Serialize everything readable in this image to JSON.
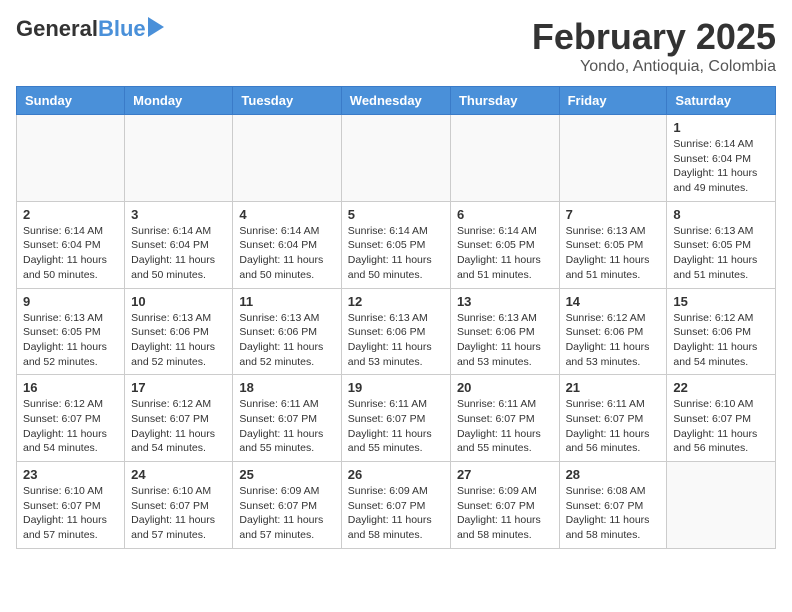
{
  "header": {
    "logo_general": "General",
    "logo_blue": "Blue",
    "main_title": "February 2025",
    "sub_title": "Yondo, Antioquia, Colombia"
  },
  "columns": [
    "Sunday",
    "Monday",
    "Tuesday",
    "Wednesday",
    "Thursday",
    "Friday",
    "Saturday"
  ],
  "weeks": [
    [
      {
        "day": "",
        "info": ""
      },
      {
        "day": "",
        "info": ""
      },
      {
        "day": "",
        "info": ""
      },
      {
        "day": "",
        "info": ""
      },
      {
        "day": "",
        "info": ""
      },
      {
        "day": "",
        "info": ""
      },
      {
        "day": "1",
        "info": "Sunrise: 6:14 AM\nSunset: 6:04 PM\nDaylight: 11 hours and 49 minutes."
      }
    ],
    [
      {
        "day": "2",
        "info": "Sunrise: 6:14 AM\nSunset: 6:04 PM\nDaylight: 11 hours and 50 minutes."
      },
      {
        "day": "3",
        "info": "Sunrise: 6:14 AM\nSunset: 6:04 PM\nDaylight: 11 hours and 50 minutes."
      },
      {
        "day": "4",
        "info": "Sunrise: 6:14 AM\nSunset: 6:04 PM\nDaylight: 11 hours and 50 minutes."
      },
      {
        "day": "5",
        "info": "Sunrise: 6:14 AM\nSunset: 6:05 PM\nDaylight: 11 hours and 50 minutes."
      },
      {
        "day": "6",
        "info": "Sunrise: 6:14 AM\nSunset: 6:05 PM\nDaylight: 11 hours and 51 minutes."
      },
      {
        "day": "7",
        "info": "Sunrise: 6:13 AM\nSunset: 6:05 PM\nDaylight: 11 hours and 51 minutes."
      },
      {
        "day": "8",
        "info": "Sunrise: 6:13 AM\nSunset: 6:05 PM\nDaylight: 11 hours and 51 minutes."
      }
    ],
    [
      {
        "day": "9",
        "info": "Sunrise: 6:13 AM\nSunset: 6:05 PM\nDaylight: 11 hours and 52 minutes."
      },
      {
        "day": "10",
        "info": "Sunrise: 6:13 AM\nSunset: 6:06 PM\nDaylight: 11 hours and 52 minutes."
      },
      {
        "day": "11",
        "info": "Sunrise: 6:13 AM\nSunset: 6:06 PM\nDaylight: 11 hours and 52 minutes."
      },
      {
        "day": "12",
        "info": "Sunrise: 6:13 AM\nSunset: 6:06 PM\nDaylight: 11 hours and 53 minutes."
      },
      {
        "day": "13",
        "info": "Sunrise: 6:13 AM\nSunset: 6:06 PM\nDaylight: 11 hours and 53 minutes."
      },
      {
        "day": "14",
        "info": "Sunrise: 6:12 AM\nSunset: 6:06 PM\nDaylight: 11 hours and 53 minutes."
      },
      {
        "day": "15",
        "info": "Sunrise: 6:12 AM\nSunset: 6:06 PM\nDaylight: 11 hours and 54 minutes."
      }
    ],
    [
      {
        "day": "16",
        "info": "Sunrise: 6:12 AM\nSunset: 6:07 PM\nDaylight: 11 hours and 54 minutes."
      },
      {
        "day": "17",
        "info": "Sunrise: 6:12 AM\nSunset: 6:07 PM\nDaylight: 11 hours and 54 minutes."
      },
      {
        "day": "18",
        "info": "Sunrise: 6:11 AM\nSunset: 6:07 PM\nDaylight: 11 hours and 55 minutes."
      },
      {
        "day": "19",
        "info": "Sunrise: 6:11 AM\nSunset: 6:07 PM\nDaylight: 11 hours and 55 minutes."
      },
      {
        "day": "20",
        "info": "Sunrise: 6:11 AM\nSunset: 6:07 PM\nDaylight: 11 hours and 55 minutes."
      },
      {
        "day": "21",
        "info": "Sunrise: 6:11 AM\nSunset: 6:07 PM\nDaylight: 11 hours and 56 minutes."
      },
      {
        "day": "22",
        "info": "Sunrise: 6:10 AM\nSunset: 6:07 PM\nDaylight: 11 hours and 56 minutes."
      }
    ],
    [
      {
        "day": "23",
        "info": "Sunrise: 6:10 AM\nSunset: 6:07 PM\nDaylight: 11 hours and 57 minutes."
      },
      {
        "day": "24",
        "info": "Sunrise: 6:10 AM\nSunset: 6:07 PM\nDaylight: 11 hours and 57 minutes."
      },
      {
        "day": "25",
        "info": "Sunrise: 6:09 AM\nSunset: 6:07 PM\nDaylight: 11 hours and 57 minutes."
      },
      {
        "day": "26",
        "info": "Sunrise: 6:09 AM\nSunset: 6:07 PM\nDaylight: 11 hours and 58 minutes."
      },
      {
        "day": "27",
        "info": "Sunrise: 6:09 AM\nSunset: 6:07 PM\nDaylight: 11 hours and 58 minutes."
      },
      {
        "day": "28",
        "info": "Sunrise: 6:08 AM\nSunset: 6:07 PM\nDaylight: 11 hours and 58 minutes."
      },
      {
        "day": "",
        "info": ""
      }
    ]
  ]
}
